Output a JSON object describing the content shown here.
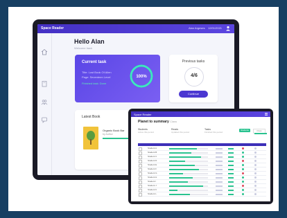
{
  "colors": {
    "frame": "#173f62",
    "accent": "#4b37d1",
    "green": "#29c28f",
    "red": "#e0455a"
  },
  "main": {
    "brand": "Space Reader",
    "user": "Alan Argeses",
    "date": "12/01/2021",
    "greeting": "Hello Alan",
    "greeting_sub": "Welcome back",
    "sidebar_icons": [
      "home-icon",
      "book-icon",
      "group-icon",
      "chat-icon"
    ],
    "current_task": {
      "title": "Current task",
      "line1": "Title: Lost Book Of Alien",
      "line2": "Page: Seventeen Level",
      "line3": "Finished task: Done",
      "percent_label": "100%",
      "percent": 100
    },
    "previous": {
      "title": "Previous tasks",
      "value": "4/6",
      "button": "Continue"
    },
    "books": {
      "title": "Latest Book",
      "book_title": "Organic Book Bar",
      "book_sub": "by Author",
      "button": "Show more"
    }
  },
  "tablet": {
    "brand": "Space Reader",
    "title": "Planet to summary",
    "title_sub": "Class",
    "stats": [
      {
        "label": "Students",
        "sub": "Active this period"
      },
      {
        "label": "Reads",
        "sub": "Updated this period"
      },
      {
        "label": "Tasks",
        "sub": "Finished this period"
      }
    ],
    "tabs": [
      "Students",
      "Class"
    ],
    "rows": [
      {
        "name": "Student A",
        "progress": 0.72,
        "flag": "red"
      },
      {
        "name": "Student B",
        "progress": 0.58,
        "flag": "green"
      },
      {
        "name": "Student C",
        "progress": 0.83,
        "flag": "green"
      },
      {
        "name": "Student D",
        "progress": 0.41,
        "flag": "red"
      },
      {
        "name": "Student E",
        "progress": 0.66,
        "flag": "green"
      },
      {
        "name": "Student F",
        "progress": 0.77,
        "flag": "green"
      },
      {
        "name": "Student G",
        "progress": 0.35,
        "flag": "red"
      },
      {
        "name": "Student H",
        "progress": 0.61,
        "flag": "green"
      },
      {
        "name": "Student I",
        "progress": 0.49,
        "flag": "green"
      },
      {
        "name": "Student J",
        "progress": 0.88,
        "flag": "red"
      },
      {
        "name": "Student K",
        "progress": 0.22,
        "flag": "green"
      },
      {
        "name": "Student L",
        "progress": 0.54,
        "flag": "green"
      }
    ]
  }
}
